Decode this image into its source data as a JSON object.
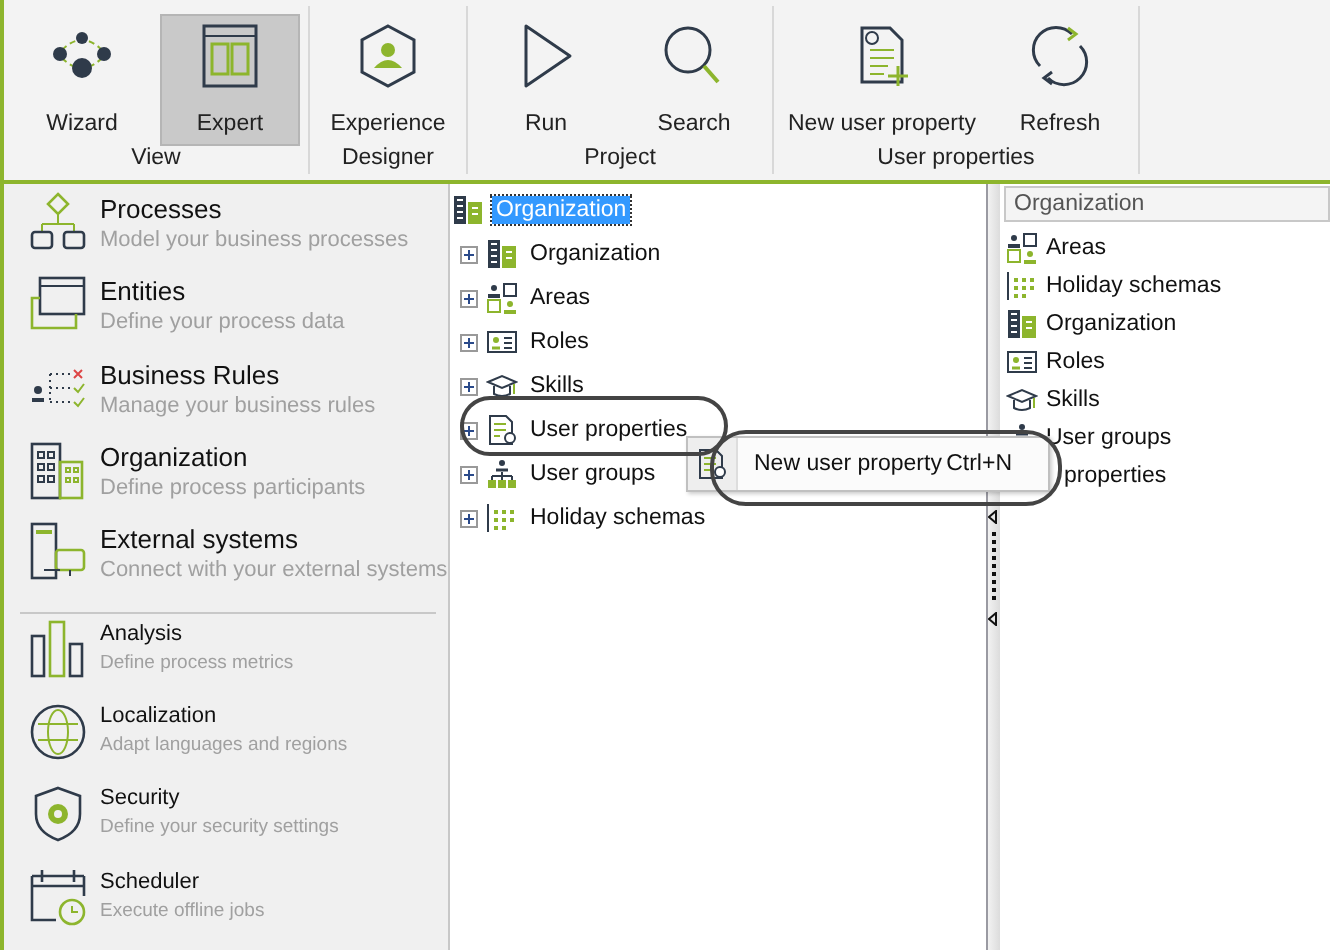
{
  "ribbon": {
    "groups": [
      {
        "label": "View",
        "buttons": [
          {
            "label": "Wizard",
            "kind": "wizard",
            "selected": false
          },
          {
            "label": "Expert",
            "kind": "expert",
            "selected": true
          }
        ]
      },
      {
        "label": "Designer",
        "buttons": [
          {
            "label": "Experience",
            "kind": "experience",
            "selected": false
          }
        ]
      },
      {
        "label": "Project",
        "buttons": [
          {
            "label": "Run",
            "kind": "run",
            "selected": false
          },
          {
            "label": "Search",
            "kind": "search",
            "selected": false
          }
        ]
      },
      {
        "label": "User properties",
        "buttons": [
          {
            "label": "New user property",
            "kind": "newprop",
            "selected": false
          },
          {
            "label": "Refresh",
            "kind": "refresh",
            "selected": false
          }
        ]
      }
    ]
  },
  "sidebar": {
    "sections": [
      [
        {
          "title": "Processes",
          "subtitle": "Model your business processes",
          "kind": "processes"
        },
        {
          "title": "Entities",
          "subtitle": "Define your process data",
          "kind": "entities"
        },
        {
          "title": "Business Rules",
          "subtitle": "Manage your business rules",
          "kind": "rules"
        },
        {
          "title": "Organization",
          "subtitle": "Define process participants",
          "kind": "organization"
        },
        {
          "title": "External systems",
          "subtitle": "Connect with your external systems",
          "kind": "external"
        }
      ],
      [
        {
          "title": "Analysis",
          "subtitle": "Define process metrics",
          "kind": "analysis"
        },
        {
          "title": "Localization",
          "subtitle": "Adapt languages and regions",
          "kind": "localization"
        },
        {
          "title": "Security",
          "subtitle": "Define your security settings",
          "kind": "security"
        },
        {
          "title": "Scheduler",
          "subtitle": "Execute offline jobs",
          "kind": "scheduler"
        }
      ]
    ]
  },
  "tree": {
    "root": {
      "label": "Organization",
      "kind": "organization",
      "selected": true,
      "children": [
        {
          "label": "Organization",
          "kind": "organization",
          "selected": false
        },
        {
          "label": "Areas",
          "kind": "areas",
          "selected": false
        },
        {
          "label": "Roles",
          "kind": "roles",
          "selected": false
        },
        {
          "label": "Skills",
          "kind": "skills",
          "selected": false
        },
        {
          "label": "User properties",
          "kind": "userprops",
          "selected": false
        },
        {
          "label": "User groups",
          "kind": "groups",
          "selected": false
        },
        {
          "label": "Holiday schemas",
          "kind": "holidays",
          "selected": false
        }
      ]
    }
  },
  "context_menu": {
    "items": [
      {
        "label": "New user property",
        "shortcut": "Ctrl+N"
      }
    ]
  },
  "detail_panel": {
    "header": "Organization",
    "items": [
      {
        "label": "Areas",
        "kind": "areas"
      },
      {
        "label": "Holiday schemas",
        "kind": "holidays"
      },
      {
        "label": "Organization",
        "kind": "organization"
      },
      {
        "label": "Roles",
        "kind": "roles"
      },
      {
        "label": "Skills",
        "kind": "skills"
      },
      {
        "label": "User groups",
        "kind": "groups"
      },
      {
        "label": "properties"
      }
    ]
  }
}
